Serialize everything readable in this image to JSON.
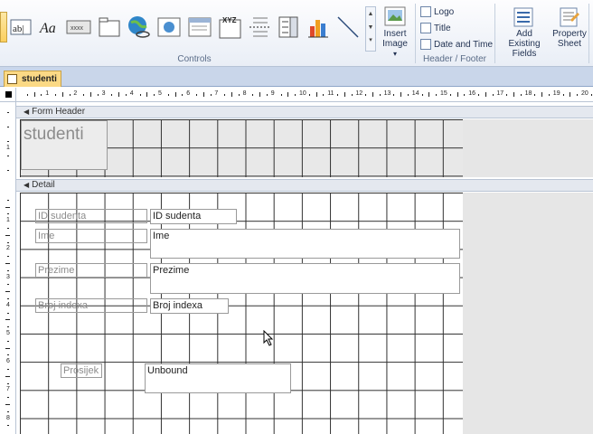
{
  "ribbon": {
    "controls_label": "Controls",
    "header_footer_label": "Header / Footer",
    "insert_image": "Insert Image",
    "insert_image_arrow": "▾",
    "logo": "Logo",
    "title": "Title",
    "date_time": "Date and Time",
    "add_existing_fields": "Add Existing Fields",
    "property_sheet": "Property Sheet",
    "controls": [
      {
        "name": "textbox-control",
        "text": "ab|"
      },
      {
        "name": "label-control",
        "text": "Aa"
      },
      {
        "name": "button-control",
        "text": "xxxx"
      },
      {
        "name": "tab-control",
        "text": ""
      },
      {
        "name": "hyperlink-control",
        "text": ""
      },
      {
        "name": "web-browser-control",
        "text": ""
      },
      {
        "name": "navigation-control",
        "text": ""
      },
      {
        "name": "option-group-control",
        "text": "XYZ"
      },
      {
        "name": "page-break-control",
        "text": ""
      },
      {
        "name": "combo-box-control",
        "text": ""
      },
      {
        "name": "chart-control",
        "text": ""
      },
      {
        "name": "line-control",
        "text": ""
      }
    ]
  },
  "tab": {
    "label": "studenti"
  },
  "ruler": {
    "h_numbers": [
      "1",
      "2",
      "3",
      "4",
      "5",
      "6",
      "7",
      "8",
      "9",
      "10",
      "11",
      "12",
      "13",
      "14",
      "15",
      "16",
      "17",
      "18",
      "19",
      "20"
    ],
    "v_numbers": [
      "1",
      "2",
      "3",
      "4",
      "5",
      "6",
      "7",
      "8"
    ]
  },
  "sections": {
    "form_header": "Form Header",
    "detail": "Detail"
  },
  "form": {
    "title": "studenti",
    "labels": {
      "id": "ID sudenta",
      "ime": "Ime",
      "prezime": "Prezime",
      "broj": "Broj indexa",
      "prosijek": "Prosijek"
    },
    "fields": {
      "id": "ID sudenta",
      "ime": "Ime",
      "prezime": "Prezime",
      "broj": "Broj indexa",
      "unbound": "Unbound"
    }
  }
}
